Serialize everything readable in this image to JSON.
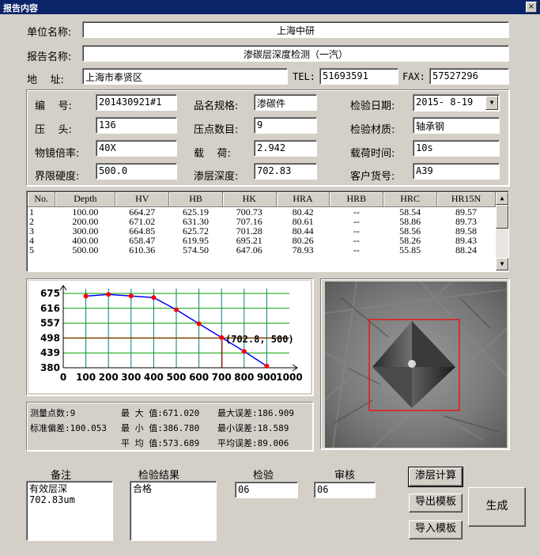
{
  "window": {
    "title": "报告内容",
    "close_glyph": "×"
  },
  "header": {
    "unit_label": "单位名称:",
    "unit_value": "上海中研",
    "report_label": "报告名称:",
    "report_value": "渗碳层深度检测（一汽）",
    "address_label": "地    址:",
    "address_value": "上海市奉贤区",
    "tel_label": "TEL:",
    "tel_value": "51693591",
    "fax_label": "FAX:",
    "fax_value": "57527296"
  },
  "info": {
    "code_label": "编    号:",
    "code_value": "201430921#1",
    "product_label": "品名规格:",
    "product_value": "渗碳件",
    "date_label": "检验日期:",
    "date_value": "2015- 8-19",
    "indenter_label": "压    头:",
    "indenter_value": "136",
    "points_label": "压点数目:",
    "points_value": "9",
    "material_label": "检验材质:",
    "material_value": "轴承钢",
    "objective_label": "物镜倍率:",
    "objective_value": "40X",
    "load_label": "载    荷:",
    "load_value": "2.942",
    "load_time_label": "载荷时间:",
    "load_time_value": "10s",
    "limit_label": "界限硬度:",
    "limit_value": "500.0",
    "depth_label": "渗层深度:",
    "depth_value": "702.83",
    "customer_label": "客户货号:",
    "customer_value": "A39"
  },
  "table": {
    "columns": [
      "No.",
      "Depth",
      "HV",
      "HB",
      "HK",
      "HRA",
      "HRB",
      "HRC",
      "HR15N"
    ],
    "rows": [
      [
        "1",
        "100.00",
        "664.27",
        "625.19",
        "700.73",
        "80.42",
        "--",
        "58.54",
        "89.57"
      ],
      [
        "2",
        "200.00",
        "671.02",
        "631.30",
        "707.16",
        "80.61",
        "--",
        "58.86",
        "89.73"
      ],
      [
        "3",
        "300.00",
        "664.85",
        "625.72",
        "701.28",
        "80.44",
        "--",
        "58.56",
        "89.58"
      ],
      [
        "4",
        "400.00",
        "658.47",
        "619.95",
        "695.21",
        "80.26",
        "--",
        "58.26",
        "89.43"
      ],
      [
        "5",
        "500.00",
        "610.36",
        "574.50",
        "647.06",
        "78.93",
        "--",
        "55.85",
        "88.24"
      ]
    ],
    "scroll_up": "▲",
    "scroll_down": "▼"
  },
  "chart_data": {
    "type": "line",
    "x": [
      100,
      200,
      300,
      400,
      500,
      600,
      700,
      800,
      900
    ],
    "y": [
      664.27,
      671.02,
      664.85,
      658.47,
      610.36,
      555.0,
      500.0,
      445.0,
      386.78
    ],
    "xticks": [
      "0",
      "100",
      "200",
      "300",
      "400",
      "500",
      "600",
      "700",
      "800",
      "900",
      "1000"
    ],
    "yticks": [
      "675",
      "616",
      "557",
      "498",
      "439",
      "380"
    ],
    "xlim": [
      0,
      1000
    ],
    "ylim": [
      380,
      675
    ],
    "annotation": "(702.8, 500)",
    "annotation_point": [
      702.8,
      500
    ],
    "colors": {
      "line": "#0000ff",
      "marker": "#ff0000",
      "grid_v": "#008080",
      "grid_h": "#00a000",
      "limit": "#804000",
      "axis": "#000000"
    }
  },
  "stats": {
    "count_label": "测量点数:",
    "count_value": "9",
    "max_label": "最 大 值:",
    "max_value": "671.020",
    "max_err_label": "最大误差:",
    "max_err_value": "186.909",
    "std_label": "标准偏差:",
    "std_value": "100.053",
    "min_label": "最 小 值:",
    "min_value": "386.780",
    "min_err_label": "最小误差:",
    "min_err_value": "18.589",
    "avg_label": "平 均 值:",
    "avg_value": "573.689",
    "avg_err_label": "平均误差:",
    "avg_err_value": "89.006"
  },
  "footer": {
    "remark_label": "备注",
    "remark_value": "有效层深\n702.83um",
    "result_label": "检验结果",
    "result_value": "合格",
    "inspect_label": "检验",
    "inspect_value": "06",
    "review_label": "审核",
    "review_value": "06"
  },
  "buttons": {
    "calc": "渗层计算",
    "export": "导出模板",
    "import": "导入模板",
    "generate": "生成"
  }
}
